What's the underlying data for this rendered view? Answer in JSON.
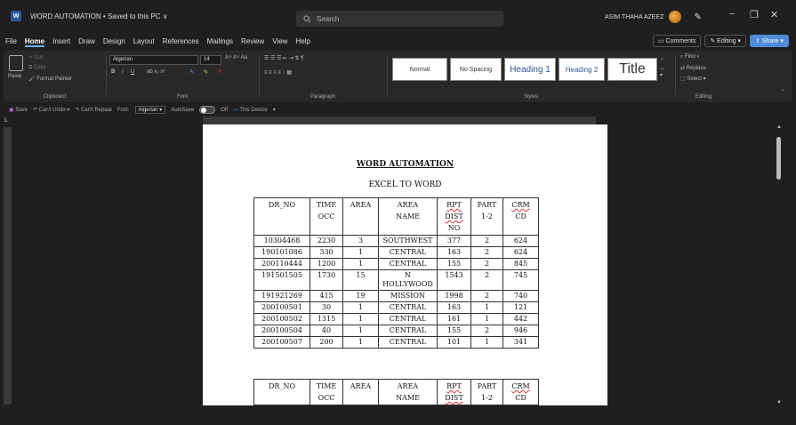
{
  "titlebar": {
    "doc_title": "WORD AUTOMATION • Saved to this PC ∨",
    "search_placeholder": "Search",
    "user_name": "ASIM THAHA AZEEZ",
    "minimize": "−",
    "maximize": "❐",
    "close": "✕"
  },
  "menu": {
    "items": [
      "File",
      "Home",
      "Insert",
      "Draw",
      "Design",
      "Layout",
      "References",
      "Mailings",
      "Review",
      "View",
      "Help"
    ],
    "active": "Home",
    "comments": "Comments",
    "editing": "Editing ▾",
    "share": "Share ▾"
  },
  "ribbon": {
    "clipboard": {
      "paste": "Paste",
      "cut": "Cut",
      "copy": "Copy",
      "format_painter": "Format Painter",
      "label": "Clipboard"
    },
    "font": {
      "name": "Algerian",
      "size": "14",
      "label": "Font"
    },
    "paragraph": {
      "label": "Paragraph"
    },
    "styles": {
      "items": [
        "Normal",
        "No Spacing",
        "Heading 1",
        "Heading 2",
        "Title"
      ],
      "label": "Styles"
    },
    "editing": {
      "find": "Find ▾",
      "replace": "Replace",
      "select": "Select ▾",
      "label": "Editing"
    }
  },
  "qat": {
    "save": "Save",
    "undo": "Can't Undo",
    "redo": "Can't Repeat",
    "font_label": "Font:",
    "font_value": "Algerian",
    "autosave": "AutoSave",
    "autosave_state": "Off",
    "this_device": "This Device"
  },
  "document": {
    "title": "WORD AUTOMATION",
    "subtitle": "EXCEL TO WORD",
    "headers": [
      [
        "DR_NO"
      ],
      [
        "TIME",
        "OCC"
      ],
      [
        "AREA"
      ],
      [
        "AREA",
        "NAME"
      ],
      [
        "RPT",
        "DIST",
        "NO"
      ],
      [
        "PART",
        "1-2"
      ],
      [
        "CRM",
        "CD"
      ]
    ],
    "rows": [
      [
        "10304468",
        "2230",
        "3",
        "SOUTHWEST",
        "377",
        "2",
        "624"
      ],
      [
        "190101086",
        "330",
        "1",
        "CENTRAL",
        "163",
        "2",
        "624"
      ],
      [
        "200110444",
        "1200",
        "1",
        "CENTRAL",
        "155",
        "2",
        "845"
      ],
      [
        "191501505",
        "1730",
        "15",
        "N HOLLYWOOD",
        "1543",
        "2",
        "745"
      ],
      [
        "191921269",
        "415",
        "19",
        "MISSION",
        "1998",
        "2",
        "740"
      ],
      [
        "200100501",
        "30",
        "1",
        "CENTRAL",
        "163",
        "1",
        "121"
      ],
      [
        "200100502",
        "1315",
        "1",
        "CENTRAL",
        "161",
        "1",
        "442"
      ],
      [
        "200100504",
        "40",
        "1",
        "CENTRAL",
        "155",
        "2",
        "946"
      ],
      [
        "200100507",
        "200",
        "1",
        "CENTRAL",
        "101",
        "1",
        "341"
      ]
    ]
  }
}
